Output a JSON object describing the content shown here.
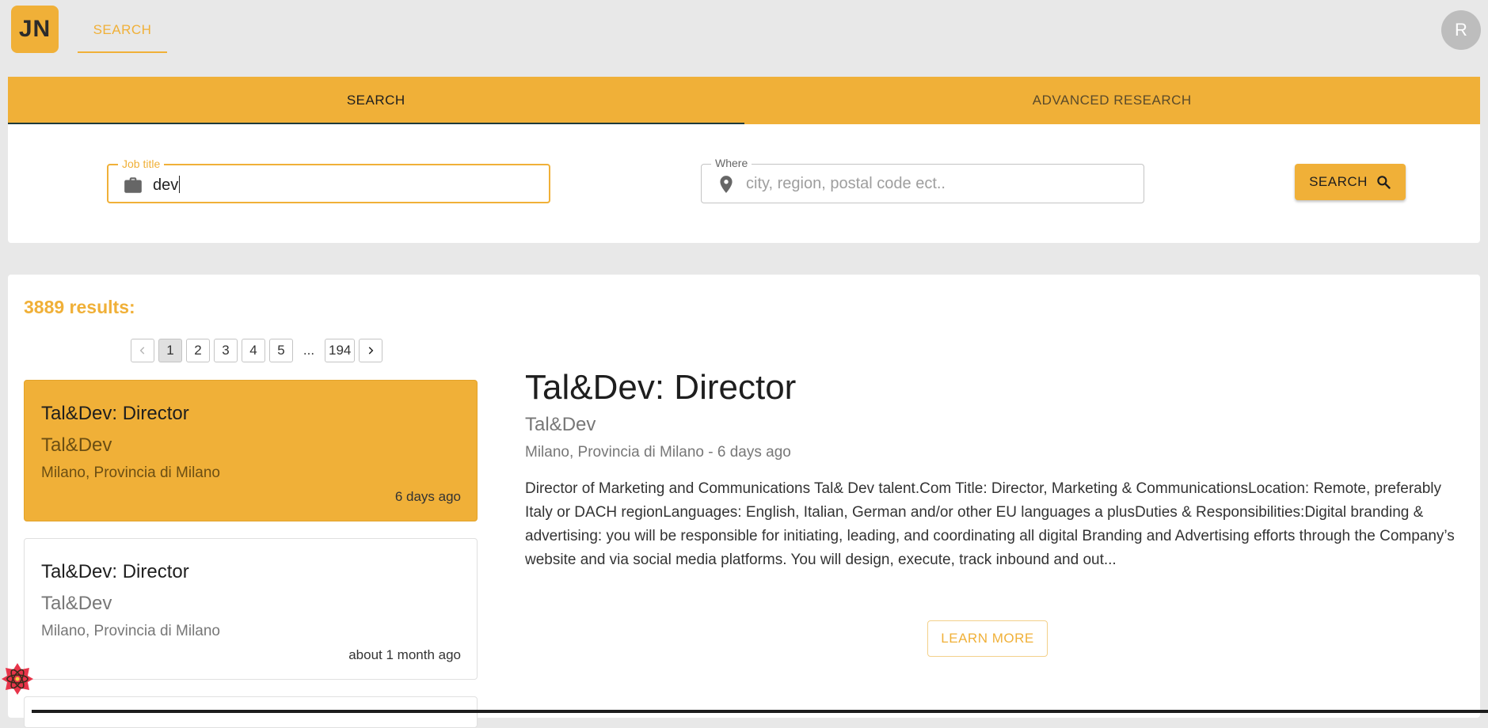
{
  "logo": {
    "text": "JN"
  },
  "topnav": {
    "search_tab": "SEARCH",
    "avatar_letter": "R"
  },
  "search_panel": {
    "tabs": [
      {
        "label": "SEARCH"
      },
      {
        "label": "ADVANCED RESEARCH"
      }
    ],
    "job_title": {
      "label": "Job title",
      "value": "dev"
    },
    "where": {
      "label": "Where",
      "placeholder": "city, region, postal code ect.."
    },
    "search_button": "SEARCH"
  },
  "results": {
    "count_text": "3889 results:",
    "pagination": {
      "pages": [
        "1",
        "2",
        "3",
        "4",
        "5"
      ],
      "ellipsis": "...",
      "last": "194",
      "current": "1"
    },
    "jobs": [
      {
        "title": "Tal&Dev: Director",
        "company": "Tal&Dev",
        "location": "Milano, Provincia di Milano",
        "age": "6 days ago"
      },
      {
        "title": "Tal&Dev: Director",
        "company": "Tal&Dev",
        "location": "Milano, Provincia di Milano",
        "age": "about 1 month ago"
      }
    ]
  },
  "detail": {
    "title": "Tal&Dev: Director",
    "company": "Tal&Dev",
    "meta": "Milano, Provincia di Milano - 6 days ago",
    "description": "Director of Marketing and Communications Tal& Dev talent.Com Title: Director, Marketing & CommunicationsLocation: Remote, preferably Italy or DACH regionLanguages: English, Italian, German and/or other EU languages a plusDuties & Responsibilities:Digital branding & advertising: you will be responsible for initiating, leading, and coordinating all digital Branding and Advertising efforts through the Company’s website and via social media platforms. You will design, execute, track inbound and out...",
    "learn_more": "LEARN MORE"
  },
  "colors": {
    "accent": "#f0b038",
    "background": "#e8e8e8"
  }
}
